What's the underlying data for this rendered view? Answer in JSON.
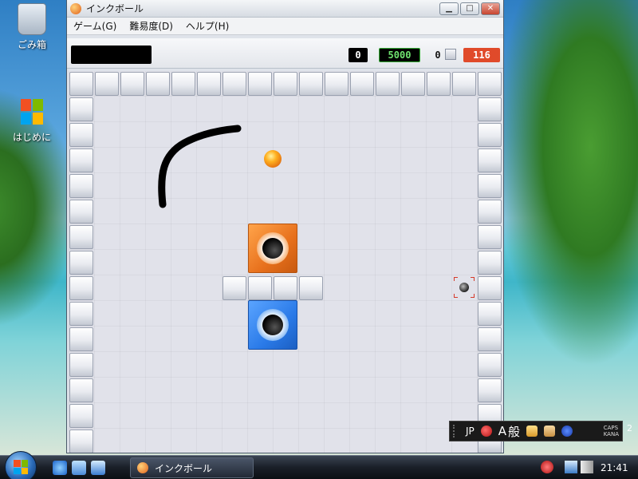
{
  "desktop": {
    "icons": [
      {
        "label": "ごみ箱",
        "icon": "recycle-bin-icon"
      },
      {
        "label": "はじめに",
        "icon": "windows-logo-icon"
      }
    ]
  },
  "window": {
    "title": "インクボール",
    "menu": [
      "ゲーム(G)",
      "難易度(D)",
      "ヘルプ(H)"
    ],
    "controls": {
      "minimize": "minimize-icon",
      "maximize": "maximize-icon",
      "close": "close-icon"
    }
  },
  "status": {
    "counter_left": "0",
    "counter_points": "5000",
    "blocks_count": "0",
    "timer": "116",
    "colors": {
      "points_text": "#6fe36f",
      "timer_bg": "#e04a2a"
    }
  },
  "game": {
    "ball_color": "#f08a1a",
    "holes": [
      {
        "color": "orange"
      },
      {
        "color": "blue"
      }
    ],
    "ink_color": "#000000"
  },
  "ime": {
    "lang": "JP",
    "mode": "A",
    "kanji": "般",
    "caps": "CAPS",
    "kana": "KANA",
    "side": "2"
  },
  "taskbar": {
    "active_app": "インクボール",
    "clock": "21:41"
  }
}
